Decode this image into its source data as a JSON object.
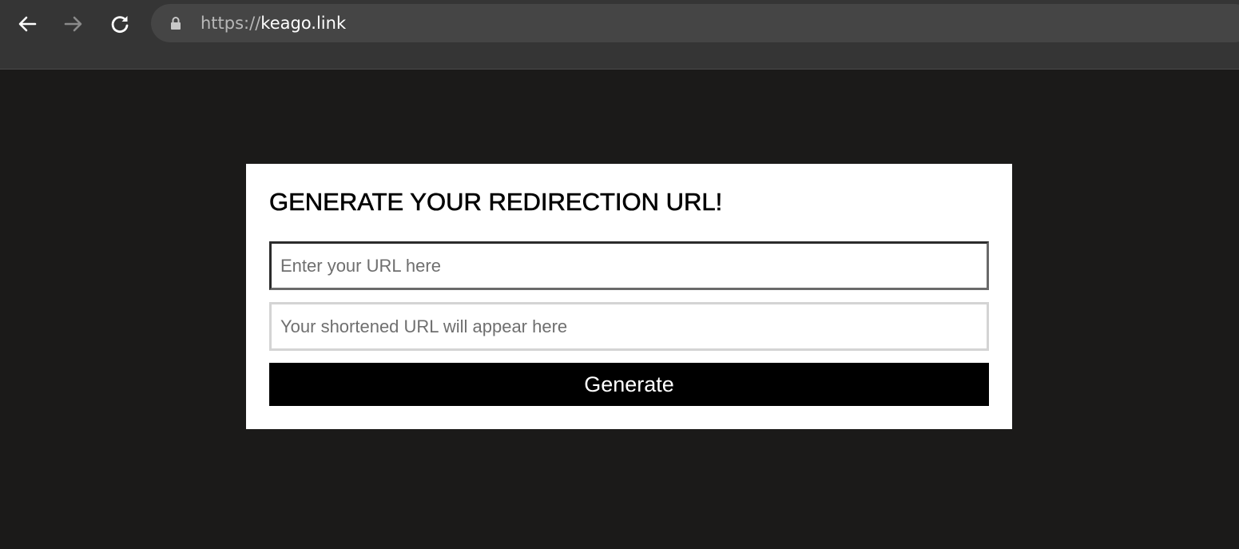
{
  "browser": {
    "url_scheme": "https://",
    "url_host": "keago.link",
    "back_icon": "arrow-left-icon",
    "forward_icon": "arrow-right-icon",
    "reload_icon": "reload-icon",
    "lock_icon": "lock-icon"
  },
  "form": {
    "title": "GENERATE YOUR REDIRECTION URL!",
    "url_input": {
      "value": "",
      "placeholder": "Enter your URL here"
    },
    "short_output": {
      "value": "",
      "placeholder": "Your shortened URL will appear here"
    },
    "generate_label": "Generate"
  },
  "colors": {
    "page_background": "#1b1a19",
    "toolbar_background": "#353535",
    "card_background": "#ffffff",
    "button_background": "#000000"
  }
}
